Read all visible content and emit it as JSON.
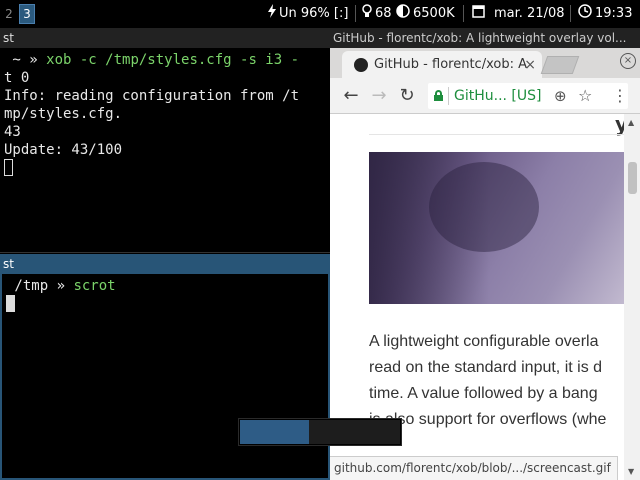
{
  "bar": {
    "workspaces": [
      {
        "label": "2",
        "focused": false
      },
      {
        "label": "3",
        "focused": true
      }
    ],
    "status": {
      "battery": "Un 96% [:]",
      "brightness": "68",
      "color_temp": "6500K",
      "date": "mar. 21/08",
      "time": "19:33"
    },
    "icons": {
      "battery": "lightning-icon",
      "brightness": "bulb-icon",
      "color_temp": "contrast-icon",
      "date": "calendar-icon",
      "time": "clock-icon"
    },
    "colors": {
      "focused_ws": "#2b5a7e"
    }
  },
  "terminal_top": {
    "title": "st",
    "prompt_symbols": " ~ » ",
    "command": "xob -c /tmp/styles.cfg -s i3 -",
    "command_wrap": "t 0",
    "lines": [
      "Info: reading configuration from /t",
      "mp/styles.cfg.",
      "43",
      "Update: 43/100"
    ]
  },
  "terminal_bottom": {
    "title": "st",
    "prompt_symbols": " /tmp » ",
    "command": "scrot",
    "colors": {
      "focused_border": "#285577"
    }
  },
  "browser": {
    "window_title": "GitHub - florentc/xob: A lightweight overlay vol...",
    "tab_title": "GitHub - florentc/xob: A",
    "tab_close": "×",
    "window_control": "×",
    "back": "←",
    "forward": "→",
    "reload": "↻",
    "address": "GitHu... [US]",
    "zoom_glyph": "⊕",
    "star_glyph": "☆",
    "menu_glyph": "⋮",
    "heading_fragment": "y",
    "description_lines": [
      "A lightweight configurable overla",
      "read on the standard input, it is d",
      "time. A value followed by a bang",
      "is also support for overflows (whe"
    ],
    "status_url": "github.com/florentc/xob/blob/.../screencast.gif",
    "scroll_up": "▲",
    "scroll_down": "▼"
  },
  "xob": {
    "value": 43,
    "max": 100,
    "colors": {
      "fill": "#2e5c86",
      "track": "#1d1d1d"
    }
  }
}
